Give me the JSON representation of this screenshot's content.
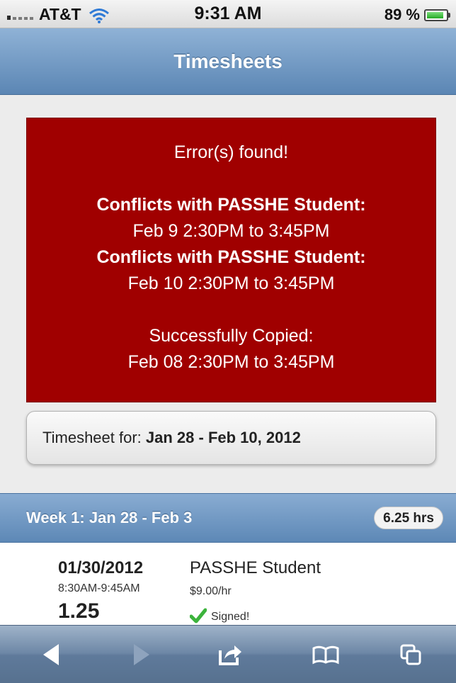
{
  "status_bar": {
    "carrier": "AT&T",
    "time": "9:31 AM",
    "battery": "89 %",
    "battery_level": 0.89
  },
  "header": {
    "title": "Timesheets"
  },
  "error_box": {
    "heading": "Error(s) found!",
    "conflicts": [
      {
        "label": "Conflicts with PASSHE Student:",
        "time": "Feb 9 2:30PM to 3:45PM"
      },
      {
        "label": "Conflicts with PASSHE Student:",
        "time": "Feb 10 2:30PM to 3:45PM"
      }
    ],
    "success_label": "Successfully Copied:",
    "success_time": "Feb 08 2:30PM to 3:45PM"
  },
  "timesheet_button": {
    "prefix": "Timesheet for: ",
    "range": "Jan 28 - Feb 10, 2012"
  },
  "week": {
    "label": "Week 1: Jan 28 - Feb 3",
    "hours": "6.25 hrs"
  },
  "entry": {
    "date": "01/30/2012",
    "time": "8:30AM-9:45AM",
    "hours": "1.25",
    "job": "PASSHE Student",
    "rate": "$9.00/hr",
    "status": "Signed!"
  },
  "toolbar": {
    "icons": [
      "back-icon",
      "forward-icon",
      "share-icon",
      "bookmarks-icon",
      "tabs-icon"
    ]
  },
  "colors": {
    "error_bg": "#a00000",
    "header_blue": "#5b86b4",
    "check_green": "#3cb33c"
  }
}
